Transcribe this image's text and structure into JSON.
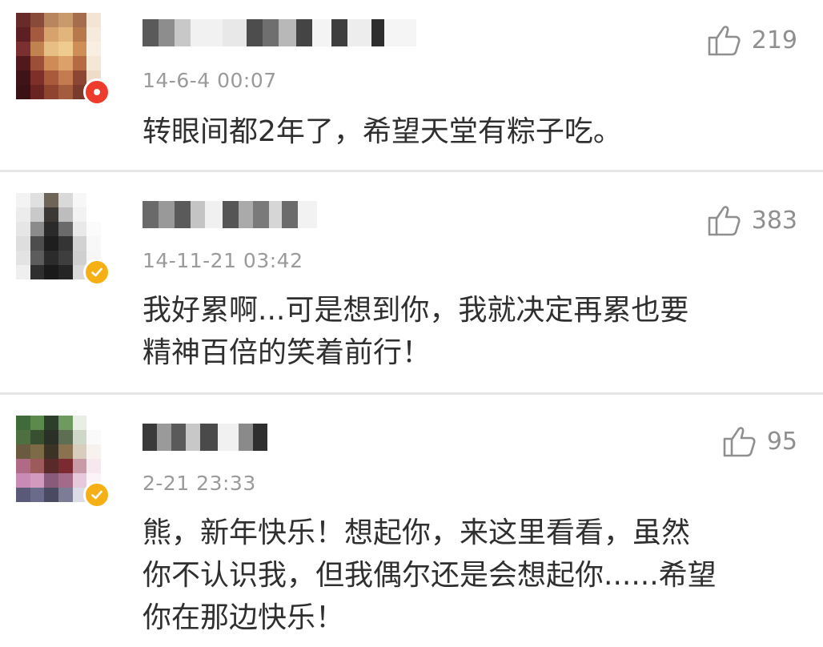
{
  "colors": {
    "badge_red": "#ee3b2b",
    "badge_gold": "#f5b015",
    "muted_text": "#9a9a9a",
    "body_text": "#2f2f2f",
    "divider": "#e6e6e6"
  },
  "comments": [
    {
      "timestamp": "14-6-4 00:07",
      "likes": "219",
      "text": "转眼间都2年了，希望天堂有粽子吃。",
      "badge": "red-verified-icon"
    },
    {
      "timestamp": "14-11-21 03:42",
      "likes": "383",
      "text": "我好累啊...可是想到你，我就决定再累也要\n精神百倍的笑着前行！",
      "badge": "gold-verified-icon"
    },
    {
      "timestamp": "2-21 23:33",
      "likes": "95",
      "text": "熊，新年快乐！想起你，来这里看看，虽然\n你不认识我，但我偶尔还是会想起你......希望\n你在那边快乐！",
      "badge": "gold-verified-icon"
    }
  ]
}
